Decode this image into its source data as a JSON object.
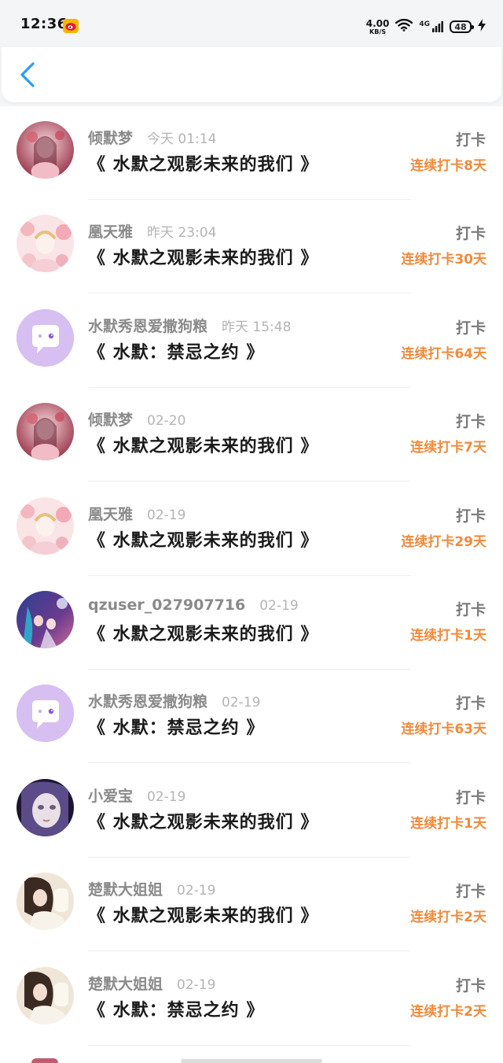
{
  "status_bar": {
    "time": "12:36",
    "net_speed_value": "4.00",
    "net_speed_unit": "KB/S",
    "signal_label": "4G",
    "battery": "48",
    "app_icon": "weibo-icon"
  },
  "header": {
    "back_icon": "chevron-left-icon"
  },
  "colors": {
    "accent": "#2a9df4",
    "streak": "#f08a3c",
    "username": "#8a8a8a",
    "timestamp": "#b4b4b4"
  },
  "checkins": [
    {
      "user": "倾默梦",
      "time": "今天 01:14",
      "book": "《 水默之观影未来的我们 》",
      "action": "打卡",
      "streak": "连续打卡8天",
      "avatar": "pink-fairy"
    },
    {
      "user": "凰天雅",
      "time": "昨天 23:04",
      "book": "《 水默之观影未来的我们 》",
      "action": "打卡",
      "streak": "连续打卡30天",
      "avatar": "pink-blossom"
    },
    {
      "user": "水默秀恩爱撒狗粮",
      "time": "昨天 15:48",
      "book": "《 水默：禁忌之约 》",
      "action": "打卡",
      "streak": "连续打卡64天",
      "avatar": "default"
    },
    {
      "user": "倾默梦",
      "time": "02-20",
      "book": "《 水默之观影未来的我们 》",
      "action": "打卡",
      "streak": "连续打卡7天",
      "avatar": "pink-fairy"
    },
    {
      "user": "凰天雅",
      "time": "02-19",
      "book": "《 水默之观影未来的我们 》",
      "action": "打卡",
      "streak": "连续打卡29天",
      "avatar": "pink-blossom"
    },
    {
      "user": "qzuser_027907716",
      "time": "02-19",
      "book": "《 水默之观影未来的我们 》",
      "action": "打卡",
      "streak": "连续打卡1天",
      "avatar": "blue-couple"
    },
    {
      "user": "水默秀恩爱撒狗粮",
      "time": "02-19",
      "book": "《 水默：禁忌之约 》",
      "action": "打卡",
      "streak": "连续打卡63天",
      "avatar": "default"
    },
    {
      "user": "小爱宝",
      "time": "02-19",
      "book": "《 水默之观影未来的我们 》",
      "action": "打卡",
      "streak": "连续打卡1天",
      "avatar": "doll-face"
    },
    {
      "user": "楚默大姐姐",
      "time": "02-19",
      "book": "《 水默之观影未来的我们 》",
      "action": "打卡",
      "streak": "连续打卡2天",
      "avatar": "girl-photo"
    },
    {
      "user": "楚默大姐姐",
      "time": "02-19",
      "book": "《 水默：禁忌之约 》",
      "action": "打卡",
      "streak": "连续打卡2天",
      "avatar": "girl-photo"
    }
  ]
}
